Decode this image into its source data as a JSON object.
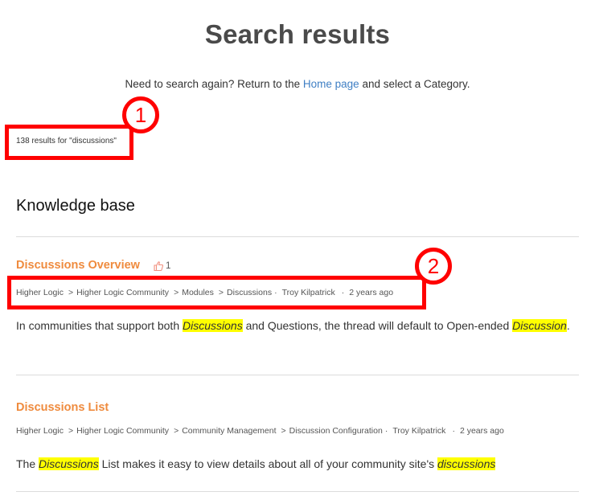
{
  "header": {
    "title": "Search results",
    "subtitle_prefix": "Need to search again? Return to the ",
    "home_link": "Home page",
    "subtitle_suffix": " and select a Category."
  },
  "results": {
    "count_text": "138 results for \"discussions\""
  },
  "section": {
    "heading": "Knowledge base"
  },
  "articles": [
    {
      "title": "Discussions Overview",
      "likes": "1",
      "breadcrumbs": [
        "Higher Logic",
        "Higher Logic Community",
        "Modules",
        "Discussions"
      ],
      "author": "Troy Kilpatrick",
      "age": "2 years ago",
      "snippet": {
        "t1": "In communities that support both ",
        "h1": "Discussions",
        "t2": " and Questions, the thread will default to Open-ended ",
        "h2": "Discussion",
        "t3": "."
      }
    },
    {
      "title": "Discussions List",
      "breadcrumbs": [
        "Higher Logic",
        "Higher Logic Community",
        "Community Management",
        "Discussion Configuration"
      ],
      "author": "Troy Kilpatrick",
      "age": "2 years ago",
      "snippet": {
        "t1": "The ",
        "h1": "Discussions",
        "t2": " List makes it easy to view details about all of your community site's ",
        "h2": "discussions"
      }
    }
  ],
  "annotations": [
    {
      "label": "1",
      "color": "#ff0000"
    },
    {
      "label": "2",
      "color": "#ff0000"
    }
  ],
  "colors": {
    "title_link": "#ef8b3e",
    "link": "#3f7fc4",
    "highlight": "#ffff00",
    "annotation": "#ff0000"
  }
}
